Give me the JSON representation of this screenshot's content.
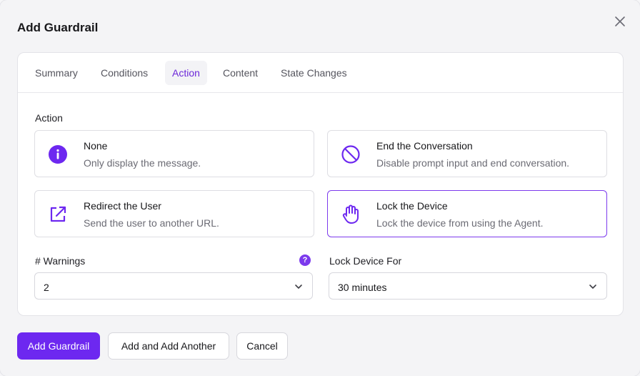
{
  "modal": {
    "title": "Add Guardrail",
    "close_icon": "close-icon"
  },
  "tabs": [
    {
      "label": "Summary",
      "active": false
    },
    {
      "label": "Conditions",
      "active": false
    },
    {
      "label": "Action",
      "active": true
    },
    {
      "label": "Content",
      "active": false
    },
    {
      "label": "State Changes",
      "active": false
    }
  ],
  "action": {
    "section_label": "Action",
    "options": [
      {
        "title": "None",
        "description": "Only display the message.",
        "icon": "info-icon",
        "selected": false
      },
      {
        "title": "End the Conversation",
        "description": "Disable prompt input and end conversation.",
        "icon": "ban-icon",
        "selected": false
      },
      {
        "title": "Redirect the User",
        "description": "Send the user to another URL.",
        "icon": "external-link-icon",
        "selected": false
      },
      {
        "title": "Lock the Device",
        "description": "Lock the device from using the Agent.",
        "icon": "hand-icon",
        "selected": true
      }
    ]
  },
  "warnings": {
    "label": "# Warnings",
    "help": "?",
    "value": "2"
  },
  "lock_for": {
    "label": "Lock Device For",
    "value": "30 minutes"
  },
  "footer": {
    "primary_label": "Add Guardrail",
    "secondary_label": "Add and Add Another",
    "cancel_label": "Cancel"
  },
  "colors": {
    "accent": "#6d28f0",
    "selected_border": "#7c3aed"
  }
}
